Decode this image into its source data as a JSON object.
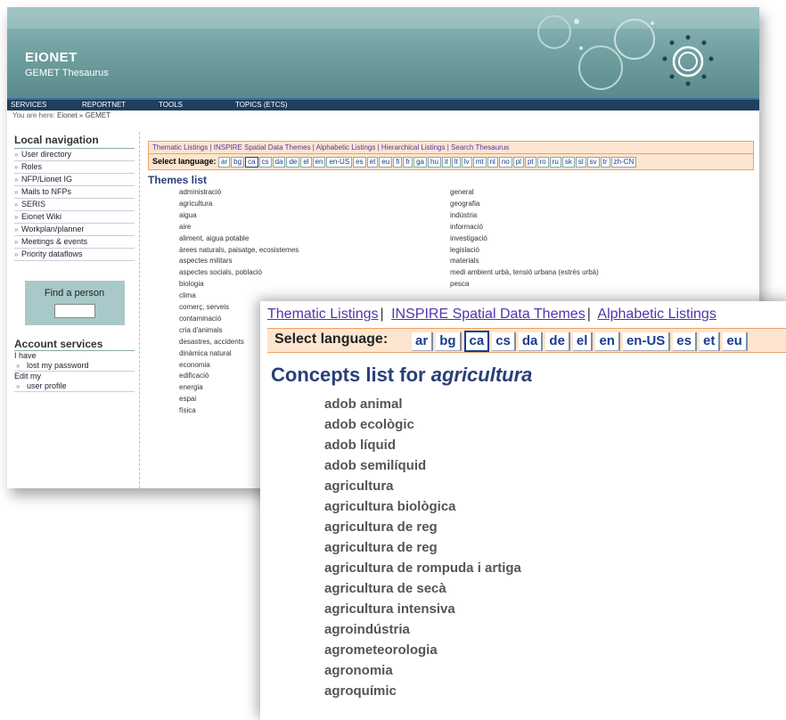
{
  "header": {
    "brand": "EIONET",
    "subtitle": "GEMET Thesaurus"
  },
  "topnav": [
    "SERVICES",
    "REPORTNET",
    "TOOLS",
    "TOPICS (ETCS)"
  ],
  "breadcrumb": {
    "prefix": "You are here:",
    "path": "Eionet » GEMET"
  },
  "sidebar": {
    "title": "Local navigation",
    "items": [
      "User directory",
      "Roles",
      "NFP/Lionet IG",
      "Mails to NFPs",
      "SERIS",
      "Eionet Wiki",
      "Workplan/planner",
      "Meetings & events",
      "Priority dataflows"
    ],
    "find_person": "Find a person",
    "account_title": "Account services",
    "account_lines": [
      {
        "text": "I have",
        "sub": "lost my password"
      },
      {
        "text": "Edit my",
        "sub": "user profile"
      }
    ]
  },
  "main": {
    "tabs": [
      "Thematic Listings",
      "INSPIRE Spatial Data Themes",
      "Alphabetic Listings",
      "Hierarchical Listings",
      "Search Thesaurus"
    ],
    "select_language_label": "Select language:",
    "languages": [
      "ar",
      "bg",
      "ca",
      "cs",
      "da",
      "de",
      "el",
      "en",
      "en-US",
      "es",
      "et",
      "eu",
      "fi",
      "fr",
      "ga",
      "hu",
      "it",
      "lt",
      "lv",
      "mt",
      "nl",
      "no",
      "pl",
      "pt",
      "ro",
      "ru",
      "sk",
      "sl",
      "sv",
      "tr",
      "zh-CN"
    ],
    "selected_language": "ca",
    "themes_title": "Themes list",
    "themes_col1": [
      "administració",
      "agricultura",
      "aigua",
      "aire",
      "aliment, aigua potable",
      "àrees naturals, paisatge, ecosistemes",
      "aspectes militars",
      "aspectes socials, població",
      "biologia",
      "clima",
      "comerç, serveis",
      "contaminació",
      "cria d'animals",
      "desastres, accidents",
      "dinàmica natural",
      "economia",
      "edificació",
      "energia",
      "espai",
      "física"
    ],
    "themes_col2": [
      "general",
      "geografia",
      "indústria",
      "informació",
      "investigació",
      "legislació",
      "materials",
      "medi ambient urbà, tensió urbana (estrès urbà)",
      "pesca"
    ]
  },
  "zoom": {
    "tabs": [
      "Thematic Listings",
      "INSPIRE Spatial Data Themes",
      "Alphabetic Listings"
    ],
    "select_language_label": "Select language:",
    "languages": [
      "ar",
      "bg",
      "ca",
      "cs",
      "da",
      "de",
      "el",
      "en",
      "en-US",
      "es",
      "et",
      "eu"
    ],
    "selected_language": "ca",
    "concepts_title_prefix": "Concepts list for",
    "concepts_title_theme": "agricultura",
    "concepts": [
      "adob animal",
      "adob ecològic",
      "adob líquid",
      "adob semilíquid",
      "agricultura",
      "agricultura biològica",
      "agricultura de reg",
      "agricultura de reg",
      "agricultura de rompuda i artiga",
      "agricultura de secà",
      "agricultura intensiva",
      "agroindústria",
      "agrometeorologia",
      "agronomia",
      "agroquímic"
    ]
  },
  "colors": {
    "header_teal": "#6e9e9e",
    "navbar": "#1e3f5e",
    "link": "#5533aa",
    "lang_band": "#fde5cf",
    "lang_border": "#f0a060",
    "title_blue": "#2a3f7a"
  }
}
